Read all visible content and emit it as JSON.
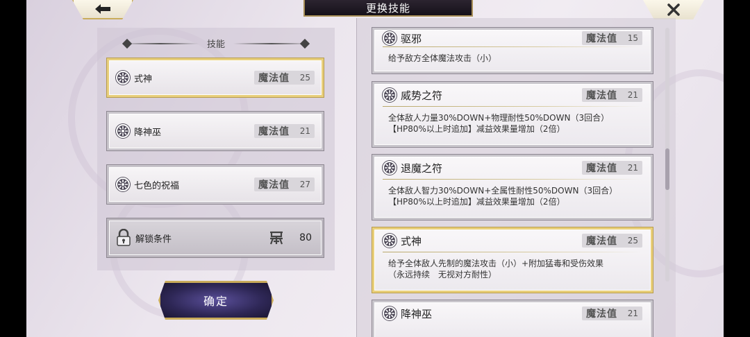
{
  "header": {
    "title": "更换技能"
  },
  "left": {
    "section_label": "技能",
    "slots": [
      {
        "name": "式神",
        "mp_label": "魔法值",
        "mp": "25"
      },
      {
        "name": "降神巫",
        "mp_label": "魔法值",
        "mp": "21"
      },
      {
        "name": "七色的祝福",
        "mp_label": "魔法值",
        "mp": "27"
      }
    ],
    "locked": {
      "label": "解锁条件",
      "value": "80",
      "icon": "unlock-level-icon"
    },
    "confirm_label": "确定"
  },
  "list": {
    "items": [
      {
        "name": "驱邪",
        "mp_label": "魔法值",
        "mp": "15",
        "desc": "给予敌方全体魔法攻击（小）"
      },
      {
        "name": "威势之符",
        "mp_label": "魔法值",
        "mp": "21",
        "desc": "全体敌人力量30%DOWN+物理耐性50%DOWN（3回合）\n【HP80%以上时追加】减益效果量增加（2倍）"
      },
      {
        "name": "退魔之符",
        "mp_label": "魔法值",
        "mp": "21",
        "desc": "全体敌人智力30%DOWN+全属性耐性50%DOWN（3回合）\n【HP80%以上时追加】减益效果量增加（2倍）"
      },
      {
        "name": "式神",
        "mp_label": "魔法值",
        "mp": "25",
        "desc": "给予全体敌人先制的魔法攻击（小）+附加猛毒和受伤效果\n（永远持续　无视对方耐性）"
      },
      {
        "name": "降神巫",
        "mp_label": "魔法值",
        "mp": "21",
        "desc": ""
      }
    ]
  },
  "colors": {
    "accent_gold": "#c9ab5a",
    "confirm_bg": "#2e2756",
    "icon_dark": "#4f4a59"
  }
}
